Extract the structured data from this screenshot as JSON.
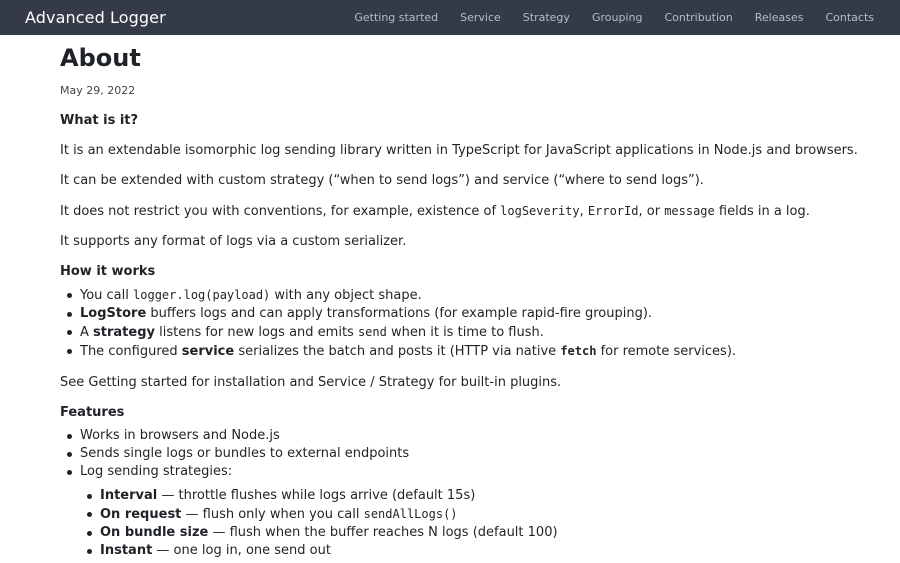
{
  "header": {
    "brand": "Advanced Logger",
    "nav": [
      "Getting started",
      "Service",
      "Strategy",
      "Grouping",
      "Contribution",
      "Releases",
      "Contacts"
    ]
  },
  "page": {
    "title": "About",
    "date": "May 29, 2022"
  },
  "what": {
    "heading": "What is it?",
    "p1": "It is an extendable isomorphic log sending library written in TypeScript for JavaScript applications in Node.js and browsers.",
    "p2": "It can be extended with custom strategy (“when to send logs”) and service (“where to send logs”).",
    "p3": {
      "pre": "It does not restrict you with conventions, for example, existence of ",
      "code1": "logSeverity",
      "sep1": ", ",
      "code2": "ErrorId",
      "sep2": ", or ",
      "code3": "message",
      "post": " fields in a log."
    },
    "p4": "It supports any format of logs via a custom serializer."
  },
  "how": {
    "heading": "How it works",
    "i1": {
      "pre": "You call ",
      "code": "logger.log(payload)",
      "post": " with any object shape."
    },
    "i2": {
      "bold": "LogStore",
      "post": " buffers logs and can apply transformations (for example rapid-fire grouping)."
    },
    "i3": {
      "pre": "A ",
      "bold": "strategy",
      "mid": " listens for new logs and emits ",
      "code": "send",
      "post": " when it is time to flush."
    },
    "i4": {
      "pre": "The configured ",
      "bold": "service",
      "mid": " serializes the batch and posts it (HTTP via native ",
      "code": "fetch",
      "post": " for remote services)."
    },
    "see": "See Getting started for installation and Service / Strategy for built-in plugins."
  },
  "features": {
    "heading": "Features",
    "items": [
      "Works in browsers and Node.js",
      "Sends single logs or bundles to external endpoints",
      "Log sending strategies:"
    ],
    "strategies": {
      "s1": {
        "bold": "Interval",
        "post": " — throttle flushes while logs arrive (default 15s)"
      },
      "s2": {
        "bold": "On request",
        "post": " — flush only when you call ",
        "code": "sendAllLogs()"
      },
      "s3": {
        "bold": "On bundle size",
        "post": " — flush when the buffer reaches N logs (default 100)"
      },
      "s4": {
        "bold": "Instant",
        "post": " — one log in, one send out"
      }
    }
  }
}
